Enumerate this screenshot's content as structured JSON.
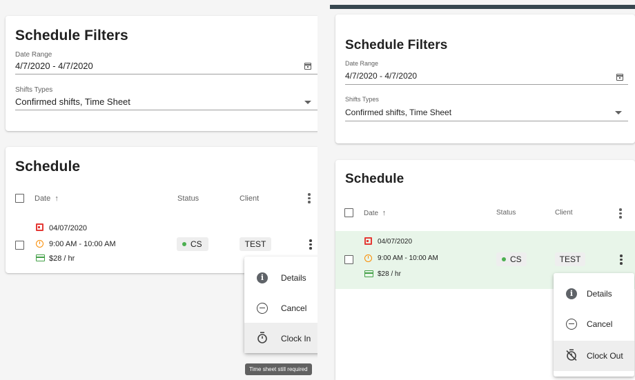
{
  "filters": {
    "title": "Schedule Filters",
    "date_range_label": "Date Range",
    "date_range_value": "4/7/2020 - 4/7/2020",
    "shift_types_label": "Shifts Types",
    "shift_types_value": "Confirmed shifts, Time Sheet"
  },
  "schedule": {
    "title": "Schedule",
    "columns": {
      "date": "Date",
      "sort_arrow": "↑",
      "status": "Status",
      "client": "Client"
    },
    "row": {
      "date": "04/07/2020",
      "time": "9:00 AM - 10:00 AM",
      "rate": "$28 / hr",
      "status": "CS",
      "client": "TEST"
    }
  },
  "left_menu": {
    "items": [
      "Details",
      "Cancel",
      "Clock In"
    ],
    "tooltip": "Time sheet still required"
  },
  "right_menu": {
    "items": [
      "Details",
      "Cancel",
      "Clock Out"
    ]
  },
  "colors": {
    "status_dot": "#4caf50",
    "date_icon": "#e53935",
    "clock_icon": "#fb8c00",
    "rate_icon": "#43a047",
    "selected_row": "#e8f5e9",
    "header_bar": "#37474f"
  },
  "icons": [
    "calendar-icon",
    "dropdown-caret-icon",
    "sort-up-icon",
    "more-vert-icon",
    "event-icon",
    "clock-icon",
    "credit-card-icon",
    "info-icon",
    "cancel-icon",
    "timer-icon",
    "timer-off-icon"
  ]
}
